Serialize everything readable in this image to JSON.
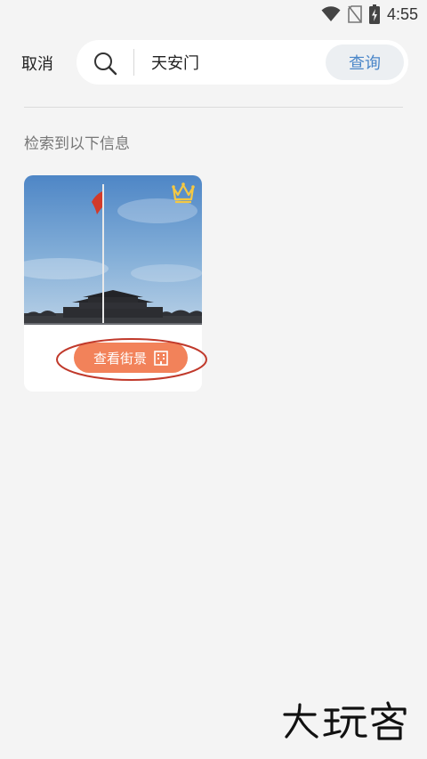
{
  "status_bar": {
    "time": "4:55",
    "icons": [
      "wifi-icon",
      "no-sim-icon",
      "battery-charging-icon"
    ]
  },
  "header": {
    "cancel_label": "取消",
    "search_value": "天安门",
    "query_label": "查询"
  },
  "results": {
    "heading": "检索到以下信息",
    "cards": [
      {
        "image": "tiananmen-square-photo",
        "badge_icon": "crown-icon",
        "button_label": "查看街景",
        "button_icon": "building-icon"
      }
    ]
  },
  "watermark": {
    "text": "大玩客"
  },
  "colors": {
    "accent_orange": "#f2825a",
    "query_blue": "#4a86c8",
    "highlight_red": "#c0392b",
    "crown_gold": "#f5c842"
  }
}
